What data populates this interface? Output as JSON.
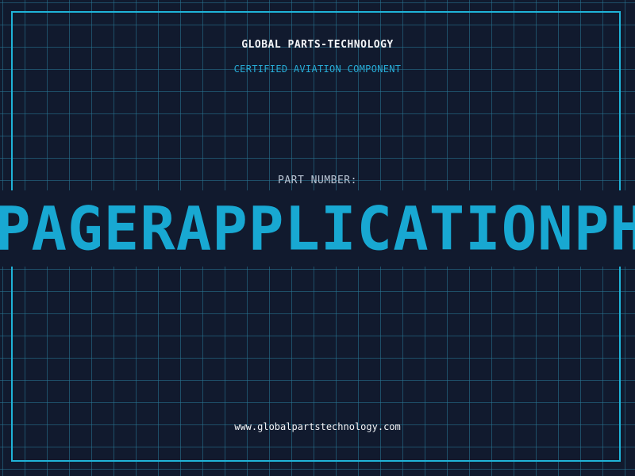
{
  "label": {
    "company": "GLOBAL PARTS-TECHNOLOGY",
    "subtitle": "CERTIFIED AVIATION COMPONENT",
    "part_number_label": "PART NUMBER:",
    "part_number_value": "PAGERAPPLICATIONPHI",
    "website": "www.globalpartstechnology.com"
  },
  "colors": {
    "background": "#111a2e",
    "grid": "#1f6f8a",
    "border": "#1fb3d8",
    "accent": "#18a8d2",
    "text": "#f2f4f7"
  }
}
